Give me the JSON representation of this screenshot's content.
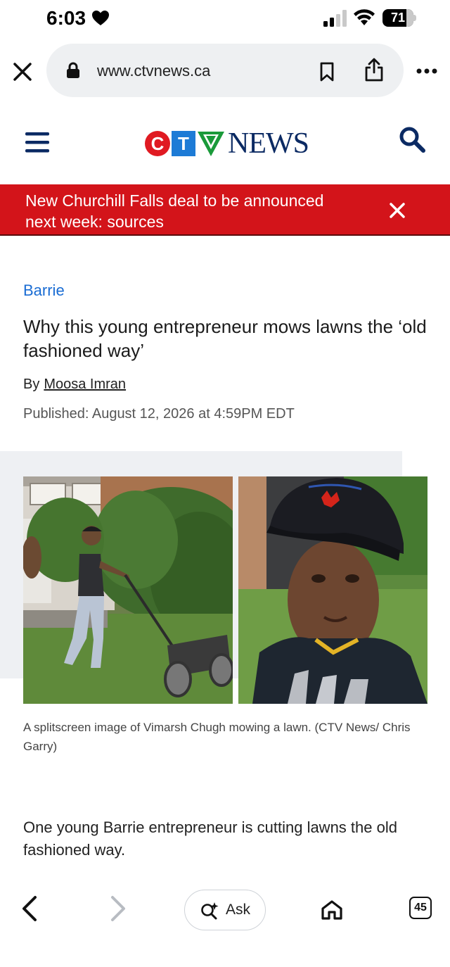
{
  "status_bar": {
    "time": "6:03",
    "battery": "71",
    "battery_level": 0.71,
    "icons": [
      "heart-icon",
      "signal-icon",
      "wifi-icon",
      "battery-icon"
    ]
  },
  "browser": {
    "url": "www.ctvnews.ca",
    "icons": [
      "close-icon",
      "lock-icon",
      "bookmark-icon",
      "share-icon",
      "more-icon"
    ]
  },
  "site": {
    "logo_ctv_c": "C",
    "logo_ctv_t": "T",
    "logo_news": "NEWS",
    "brand_colors": {
      "red": "#e01a22",
      "blue": "#1d7bd6",
      "green": "#1a9a3a",
      "navy": "#0b2a63"
    }
  },
  "alert": {
    "text": "New Churchill Falls deal to be announced next week: sources",
    "background": "#d3141a"
  },
  "article": {
    "category": "Barrie",
    "headline": "Why this young entrepreneur mows lawns the ‘old fashioned way’",
    "by": "By",
    "author": "Moosa Imran",
    "published": "Published: August 12, 2026 at 4:59PM EDT",
    "caption": "A splitscreen image of Vimarsh Chugh mowing a lawn. (CTV News/ Chris Garry)",
    "body": "One young Barrie entrepreneur is cutting lawns the old fashioned way."
  },
  "toolbar": {
    "ask_label": "Ask",
    "tab_count": "45",
    "icons": [
      "back-icon",
      "forward-icon",
      "ask-sparkle-icon",
      "home-icon",
      "tabs-icon"
    ]
  }
}
